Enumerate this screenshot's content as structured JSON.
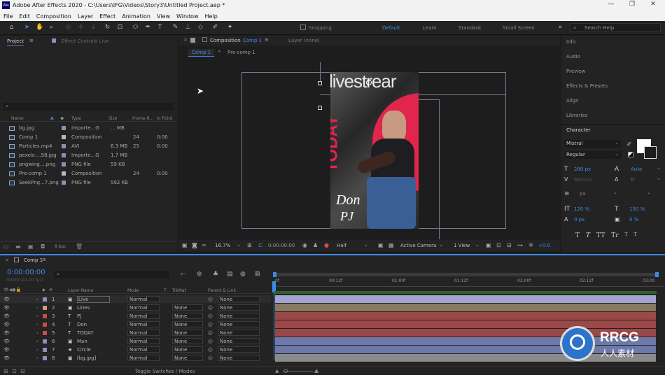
{
  "titlebar": {
    "icon": "Ae",
    "title": "Adobe After Effects 2020 - C:\\Users\\IFG\\Videos\\Story3\\Untitled Project.aep *",
    "minimize": "—",
    "maximize": "❐",
    "close": "✕"
  },
  "menu": [
    "File",
    "Edit",
    "Composition",
    "Layer",
    "Effect",
    "Animation",
    "View",
    "Window",
    "Help"
  ],
  "toolbar": {
    "snapping": "Snapping",
    "workspaces": [
      "Default",
      "Learn",
      "Standard",
      "Small Screen"
    ],
    "active_workspace": "Default",
    "search_placeholder": "Search Help"
  },
  "project": {
    "tab": "Project",
    "effect_tab": "Effect Controls Live",
    "search_placeholder": "",
    "columns": [
      "Name",
      "Type",
      "Size",
      "Frame R...",
      "In Point"
    ],
    "files": [
      {
        "name": "bg.jpg",
        "type": "Importe...G",
        "size": "... MB",
        "fr": "",
        "in": "",
        "color": "#8e8ebd"
      },
      {
        "name": "Comp 1",
        "type": "Composition",
        "size": "",
        "fr": "24",
        "in": "0:00",
        "color": "#b9b9b9"
      },
      {
        "name": "Particles.mp4",
        "type": "AVI",
        "size": "6.3 MB",
        "fr": "25",
        "in": "0:00",
        "color": "#8e8ebd"
      },
      {
        "name": "pexels-...98.jpg",
        "type": "Importe...G",
        "size": "1.7 MB",
        "fr": "",
        "in": "",
        "color": "#8e8ebd"
      },
      {
        "name": "pngwing....png",
        "type": "PNG file",
        "size": "59 KB",
        "fr": "",
        "in": "",
        "color": "#8e8ebd"
      },
      {
        "name": "Pre-comp 1",
        "type": "Composition",
        "size": "",
        "fr": "24",
        "in": "0:00",
        "color": "#b9b9b9"
      },
      {
        "name": "SeekPng...7.png",
        "type": "PNG file",
        "size": "592 KB",
        "fr": "",
        "in": "",
        "color": "#8e8ebd"
      }
    ],
    "bpc": "8 bpc"
  },
  "comp": {
    "tab_label": "Composition",
    "tab_name": "Comp 1",
    "layer_tab": "Layer (none)",
    "crumbs": [
      "Comp 1",
      "Pre-comp 1"
    ],
    "zoom": "16.7%",
    "timecode": "0:00:00:00",
    "quality": "Half",
    "camera": "Active Camera",
    "view": "1 View",
    "exposure": "+0.0",
    "art": {
      "brand": "livestrear",
      "today": "TODAY",
      "name1": "Don",
      "name2": "PJ"
    }
  },
  "right": {
    "items": [
      "Info",
      "Audio",
      "Preview",
      "Effects & Presets",
      "Align",
      "Libraries",
      "Character"
    ],
    "font": "Mistral",
    "style": "Regular",
    "size": "280 px",
    "leading": "Auto",
    "tracking_label": "Metrics",
    "tracking": "0",
    "unit": "px",
    "vscale": "120 %",
    "hscale": "100 %",
    "baseline": "0 px",
    "tsume": "0 %",
    "styles": [
      "T",
      "T",
      "TT",
      "Tr",
      "T",
      "T"
    ]
  },
  "timeline": {
    "tab": "Comp 1",
    "time": "0:00:00:00",
    "sub": "00000 (24.00 fps)",
    "cols": {
      "name": "Layer Name",
      "mode": "Mode",
      "t": "T",
      "trk": "TrkMat",
      "parent": "Parent & Link"
    },
    "ruler": [
      "0f",
      "00:12f",
      "01:00f",
      "01:12f",
      "02:00f",
      "02:12f",
      "03:00"
    ],
    "layers": [
      {
        "num": "1",
        "name": "Live",
        "mode": "Normal",
        "trk": "",
        "parent": "None",
        "color": "#8e8ebd",
        "bar": "#a3a3d0",
        "icon": "▣"
      },
      {
        "num": "2",
        "name": "Lines",
        "mode": "Normal",
        "trk": "None",
        "parent": "None",
        "color": "#c4a26a",
        "bar": "#8a7a62",
        "icon": "▣"
      },
      {
        "num": "3",
        "name": "PJ",
        "mode": "Normal",
        "trk": "None",
        "parent": "None",
        "color": "#c94c4c",
        "bar": "#9a4848",
        "icon": "T"
      },
      {
        "num": "4",
        "name": "Don",
        "mode": "Normal",
        "trk": "None",
        "parent": "None",
        "color": "#c94c4c",
        "bar": "#9a4848",
        "icon": "T"
      },
      {
        "num": "5",
        "name": "TODAY",
        "mode": "Normal",
        "trk": "None",
        "parent": "None",
        "color": "#c94c4c",
        "bar": "#9a4848",
        "icon": "T"
      },
      {
        "num": "6",
        "name": "Man",
        "mode": "Normal",
        "trk": "None",
        "parent": "None",
        "color": "#8e8ebd",
        "bar": "#6d7aa9",
        "icon": "▣"
      },
      {
        "num": "7",
        "name": "Circle",
        "mode": "Normal",
        "trk": "None",
        "parent": "None",
        "color": "#8e8ebd",
        "bar": "#6d7aa9",
        "icon": "★"
      },
      {
        "num": "8",
        "name": "[bg.jpg]",
        "mode": "Normal",
        "trk": "None",
        "parent": "None",
        "color": "#8e8ebd",
        "bar": "#8a8a8a",
        "icon": "▣"
      }
    ],
    "footer": "Toggle Switches / Modes"
  },
  "watermark": {
    "logo": "RRCG",
    "sub": "人人素材"
  }
}
